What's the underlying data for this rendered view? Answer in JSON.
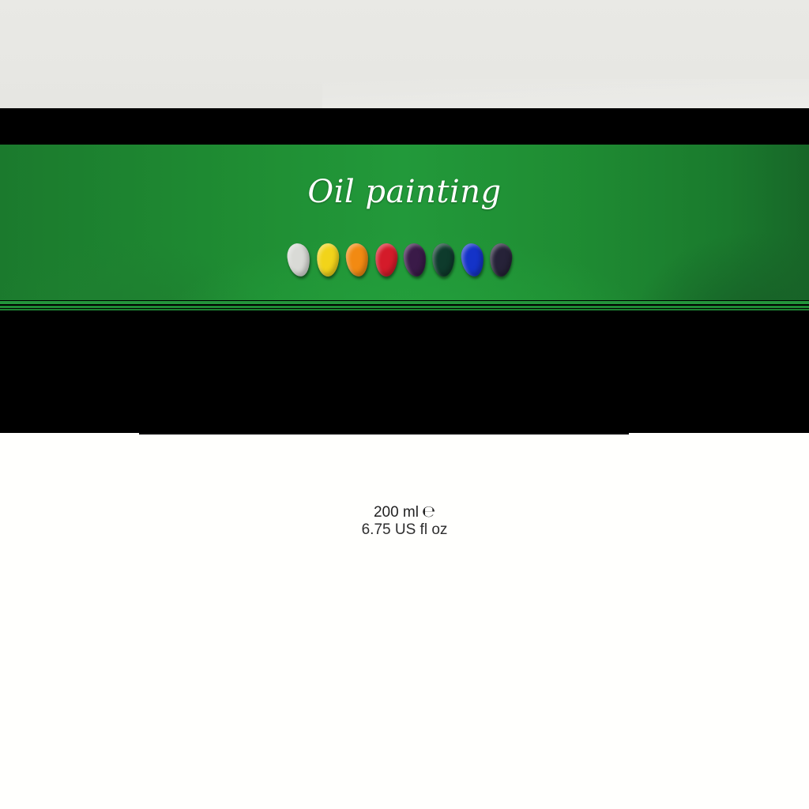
{
  "label": {
    "title": "Oil painting",
    "volume_metric": "200 ml",
    "estimated_sign": "℮",
    "volume_us": "6.75 US fl oz"
  },
  "swatches": [
    {
      "name": "white",
      "color": "#d9dad6"
    },
    {
      "name": "yellow",
      "color": "#f2d41a"
    },
    {
      "name": "orange",
      "color": "#f28a12"
    },
    {
      "name": "red",
      "color": "#d41b2a"
    },
    {
      "name": "violet",
      "color": "#3a1a48"
    },
    {
      "name": "dark-green",
      "color": "#0e3b2c"
    },
    {
      "name": "blue",
      "color": "#1433c8"
    },
    {
      "name": "indigo",
      "color": "#262238"
    }
  ],
  "colors": {
    "green_band": "#22993a",
    "top_band": "#e8e8e4",
    "bars": "#000000",
    "text": "#222222"
  }
}
